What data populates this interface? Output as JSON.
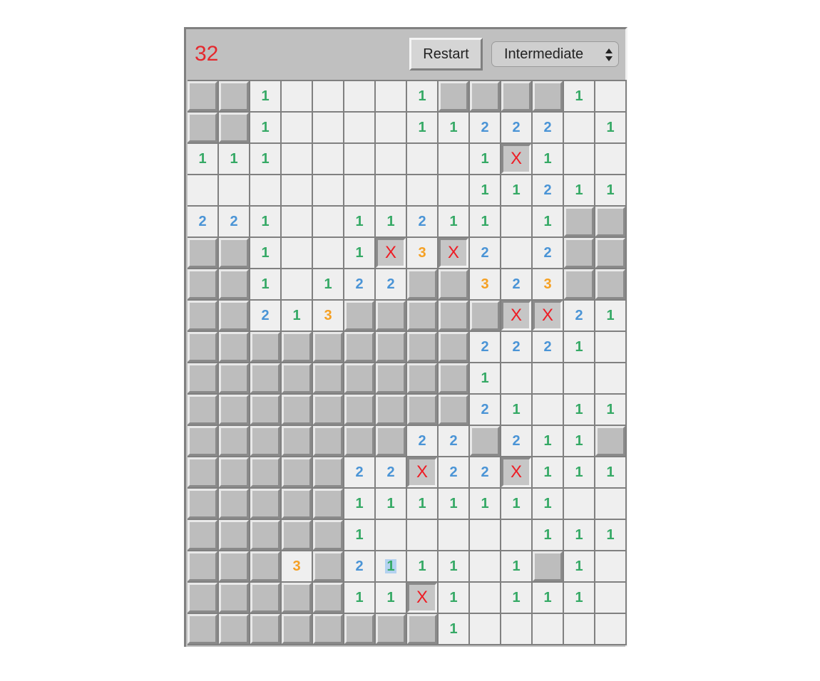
{
  "header": {
    "mine_count": "32",
    "restart_label": "Restart",
    "level_selected": "Intermediate"
  },
  "colors": {
    "mine_count": "#e5282d",
    "one": "#35a965",
    "two": "#4a94d6",
    "three": "#f5a023",
    "flag": "#ee1c24",
    "hidden_cell": "#bdbdbd",
    "open_cell": "#efefef"
  },
  "legend": {
    "hidden": "#",
    "open": ".",
    "flag": "x",
    "numbers": "1-3"
  },
  "board": {
    "rows": [
      "##1....1####1.",
      "##1....11222.1",
      "111......1x1..",
      ".........11211",
      "221..11211.1##",
      "##1..1x3x2.2##",
      "##1.122##323##",
      "##213#####xx21",
      "#########2221.",
      "#########1....",
      "#########21.11",
      "#######22#211#",
      "#####22x22x111",
      "#####1111111..",
      "#####1.....111",
      "###3#2111.1#1.",
      "#####11x1.111.",
      "########1....."
    ],
    "flag_label": "X",
    "selected_cell": [
      15,
      6
    ]
  }
}
